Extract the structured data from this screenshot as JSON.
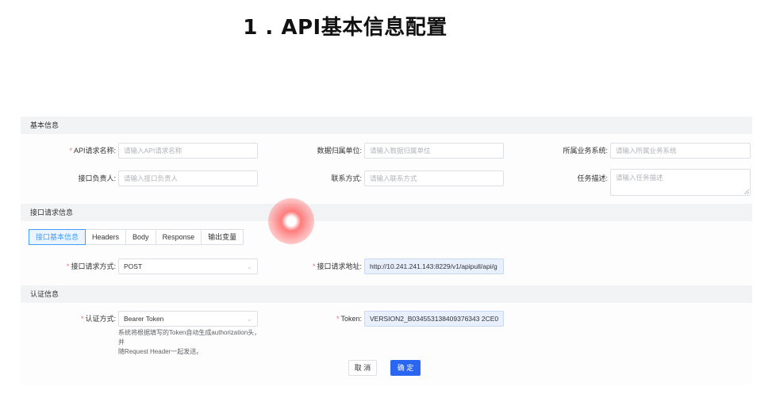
{
  "slide_title": "1 . API基本信息配置",
  "sections": {
    "basic": "基本信息",
    "request": "接口请求信息",
    "auth": "认证信息"
  },
  "basic": {
    "api_name_label": "API请求名称:",
    "api_name_placeholder": "请输入API请求名称",
    "owner_unit_label": "数据归属单位:",
    "owner_unit_placeholder": "请输入数据归属单位",
    "system_label": "所属业务系统:",
    "system_placeholder": "请输入所属业务系统",
    "person_label": "接口负责人:",
    "person_placeholder": "请输入接口负责人",
    "contact_label": "联系方式:",
    "contact_placeholder": "请输入联系方式",
    "task_desc_label": "任务描述:",
    "task_desc_placeholder": "请输入任务描述"
  },
  "tabs": [
    "接口基本信息",
    "Headers",
    "Body",
    "Response",
    "输出变量"
  ],
  "request": {
    "method_label": "接口请求方式:",
    "method_value": "POST",
    "url_label": "接口请求地址:",
    "url_value": "http://10.241.241.143:8229/v1/apipull/api/g"
  },
  "auth": {
    "type_label": "认证方式:",
    "type_value": "Bearer Token",
    "help_line1": "系统将根据填写的Token自动生成authorization头，并",
    "help_line2": "随Request Header一起发送。",
    "token_label": "Token:",
    "token_value": "VERSION2_B034553138409376343 2CE0"
  },
  "buttons": {
    "cancel": "取 消",
    "confirm": "确 定"
  },
  "colors": {
    "primary": "#2a66f2",
    "required": "#f56c6c",
    "active_tab": "#409eff"
  }
}
